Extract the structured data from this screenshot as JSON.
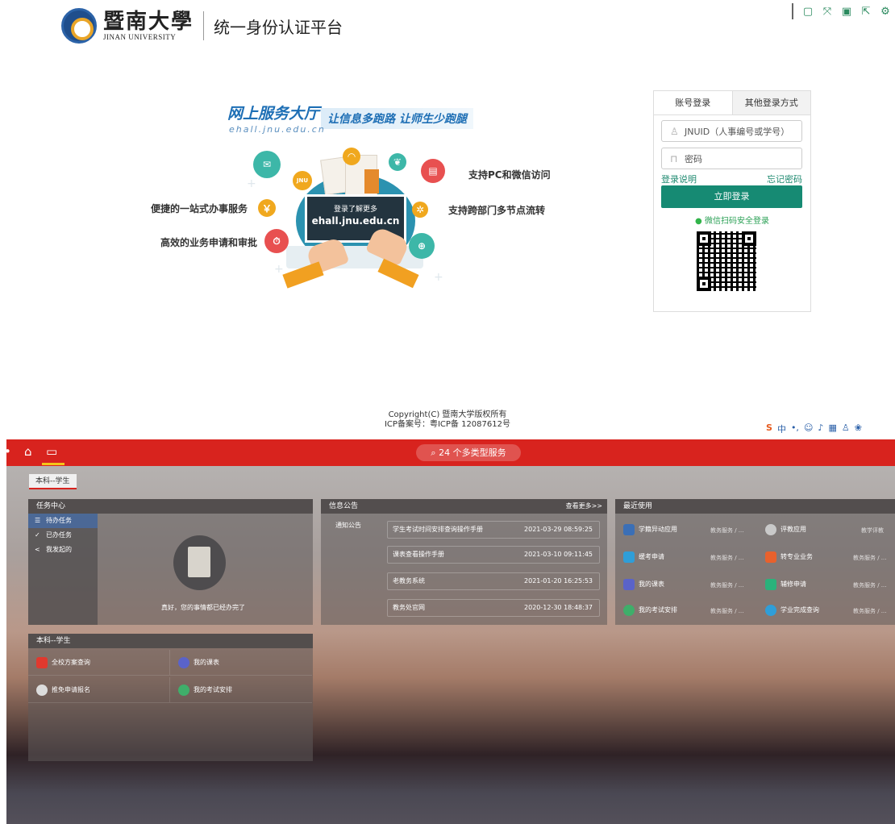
{
  "login": {
    "university_cn": "暨南大學",
    "university_en": "JINAN UNIVERSITY",
    "platform_title": "统一身份认证平台",
    "banner_title": "网上服务大厅",
    "banner_slogan": "让信息多跑路 让师生少跑腿",
    "banner_url": "ehall.jnu.edu.cn",
    "screen_line1": "登录了解更多",
    "screen_line2": "ehall.jnu.edu.cn",
    "features": [
      "支持PC和微信访问",
      "便捷的一站式办事服务",
      "支持跨部门多节点流转",
      "高效的业务申请和审批"
    ],
    "tab_account": "账号登录",
    "tab_other": "其他登录方式",
    "username_placeholder": "JNUID（人事编号或学号）",
    "password_placeholder": "密码",
    "login_help": "登录说明",
    "forgot_password": "忘记密码",
    "login_button": "立即登录",
    "wechat_login": "微信扫码安全登录",
    "copyright": "Copyright(C) 暨南大学版权所有",
    "icp": "ICP备案号：粤ICP备 12087612号"
  },
  "dashboard": {
    "search_label": "24 个多类型服务",
    "role_tab": "本科--学生",
    "task_center": {
      "title": "任务中心",
      "items": [
        "待办任务",
        "已办任务",
        "我发起的"
      ],
      "empty_message": "真好，您的事情都已经办完了"
    },
    "announcements": {
      "title": "信息公告",
      "more": "查看更多>>",
      "category": "通知公告",
      "items": [
        {
          "title": "学生考试时间安排查询操作手册",
          "date": "2021-03-29 08:59:25"
        },
        {
          "title": "课表查看操作手册",
          "date": "2021-03-10 09:11:45"
        },
        {
          "title": "老教务系统",
          "date": "2021-01-20 16:25:53"
        },
        {
          "title": "教务处官网",
          "date": "2020-12-30 18:48:37"
        }
      ]
    },
    "recent": {
      "title": "最近使用",
      "items": [
        {
          "name": "学籍异动应用",
          "category": "教务服务 / ...",
          "color": "#3b6fb6"
        },
        {
          "name": "评教应用",
          "category": "教学评教",
          "color": "#c9c9c9"
        },
        {
          "name": "缓考申请",
          "category": "教务服务 / ...",
          "color": "#2f9ed8"
        },
        {
          "name": "转专业业务",
          "category": "教务服务 / ...",
          "color": "#e8612c"
        },
        {
          "name": "我的课表",
          "category": "教务服务 / ...",
          "color": "#5a63c9"
        },
        {
          "name": "辅修申请",
          "category": "教务服务 / ...",
          "color": "#2ab27b"
        },
        {
          "name": "我的考试安排",
          "category": "教务服务 / ...",
          "color": "#3fae6a"
        },
        {
          "name": "学业完成查询",
          "category": "教务服务 / ...",
          "color": "#2f9ed8"
        }
      ]
    },
    "student_panel": {
      "title": "本科--学生",
      "services": [
        {
          "name": "全校方案查询",
          "color": "#e0392e"
        },
        {
          "name": "我的课表",
          "color": "#5a63c9"
        },
        {
          "name": "推免申请报名",
          "color": "#dcdcdc"
        },
        {
          "name": "我的考试安排",
          "color": "#3fae6a"
        }
      ]
    }
  }
}
